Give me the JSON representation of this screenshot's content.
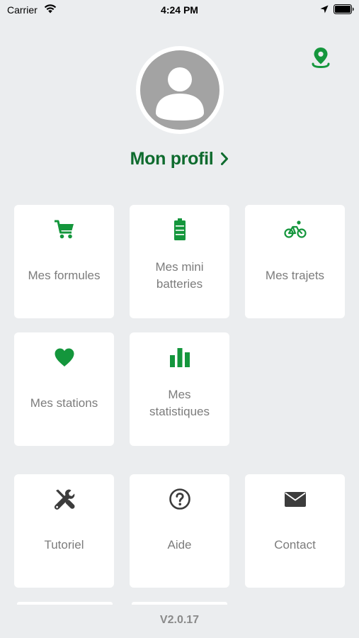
{
  "status_bar": {
    "carrier": "Carrier",
    "time": "4:24 PM",
    "icons": [
      "wifi-icon",
      "location-arrow-icon",
      "battery-icon"
    ]
  },
  "header": {
    "map_pin_icon": "map-pin-icon",
    "avatar_icon": "user-avatar-icon",
    "profile_label": "Mon profil",
    "profile_chevron_icon": "chevron-right-icon"
  },
  "colors": {
    "accent_green": "#0e6b2e",
    "icon_green": "#14963c",
    "icon_dark": "#3c3c3c",
    "label_gray": "#7c7c7c",
    "background": "#ebedef",
    "tile_background": "#ffffff"
  },
  "tiles": [
    {
      "label": "Mes formules",
      "icon": "cart-icon"
    },
    {
      "label": "Mes mini\nbatteries",
      "icon": "battery-icon"
    },
    {
      "label": "Mes trajets",
      "icon": "bicycle-icon"
    },
    {
      "label": "Mes stations",
      "icon": "heart-icon"
    },
    {
      "label": "Mes\nstatistiques",
      "icon": "bar-chart-icon"
    },
    {
      "label": "Tutoriel",
      "icon": "tools-icon"
    },
    {
      "label": "Aide",
      "icon": "help-circle-icon"
    },
    {
      "label": "Contact",
      "icon": "envelope-icon"
    }
  ],
  "footer": {
    "version": "V2.0.17"
  }
}
